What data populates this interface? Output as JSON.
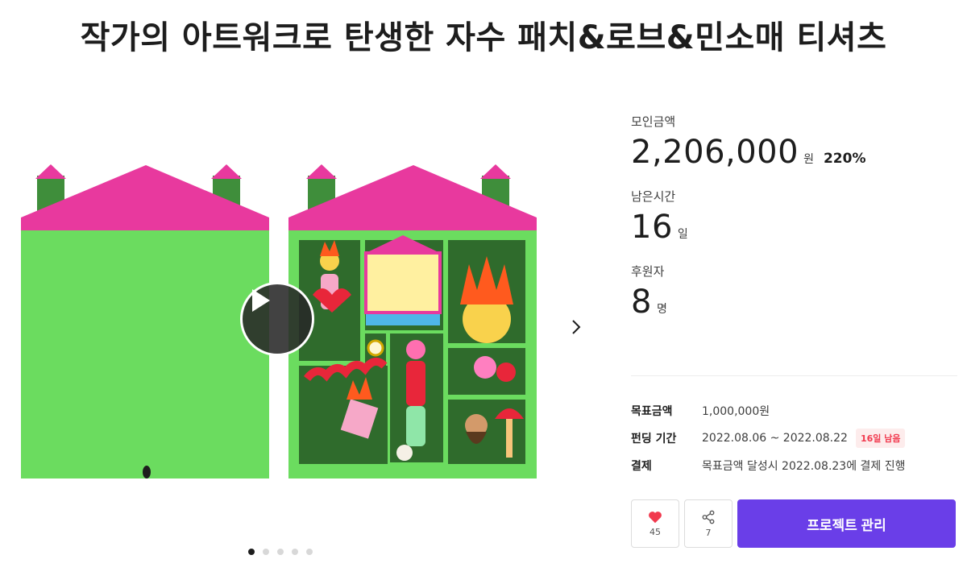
{
  "project": {
    "title": "작가의 아트워크로 탄생한 자수 패치&로브&민소매 티셔츠"
  },
  "stats": {
    "raised_label": "모인금액",
    "raised_amount": "2,206,000",
    "raised_unit": "원",
    "percent": "220%",
    "time_left_label": "남은시간",
    "time_left_value": "16",
    "time_left_unit": "일",
    "backers_label": "후원자",
    "backers_value": "8",
    "backers_unit": "명"
  },
  "info": {
    "goal_key": "목표금액",
    "goal_value": "1,000,000원",
    "period_key": "펀딩 기간",
    "period_value": "2022.08.06 ~ 2022.08.22",
    "period_badge": "16일 남음",
    "payment_key": "결제",
    "payment_value": "목표금액 달성시 2022.08.23에 결제 진행"
  },
  "actions": {
    "like_count": "45",
    "share_count": "7",
    "manage_label": "프로젝트 관리"
  },
  "carousel": {
    "slide_count": 5,
    "active_index": 0
  },
  "colors": {
    "accent": "#6a3ee8",
    "roof": "#e8399e",
    "house_green": "#6bdc5f",
    "chimney": "#3f8e3b",
    "heart": "#f1394e"
  },
  "icons": {
    "play": "play-icon",
    "next": "chevron-right-icon",
    "like": "heart-icon",
    "share": "share-icon"
  }
}
